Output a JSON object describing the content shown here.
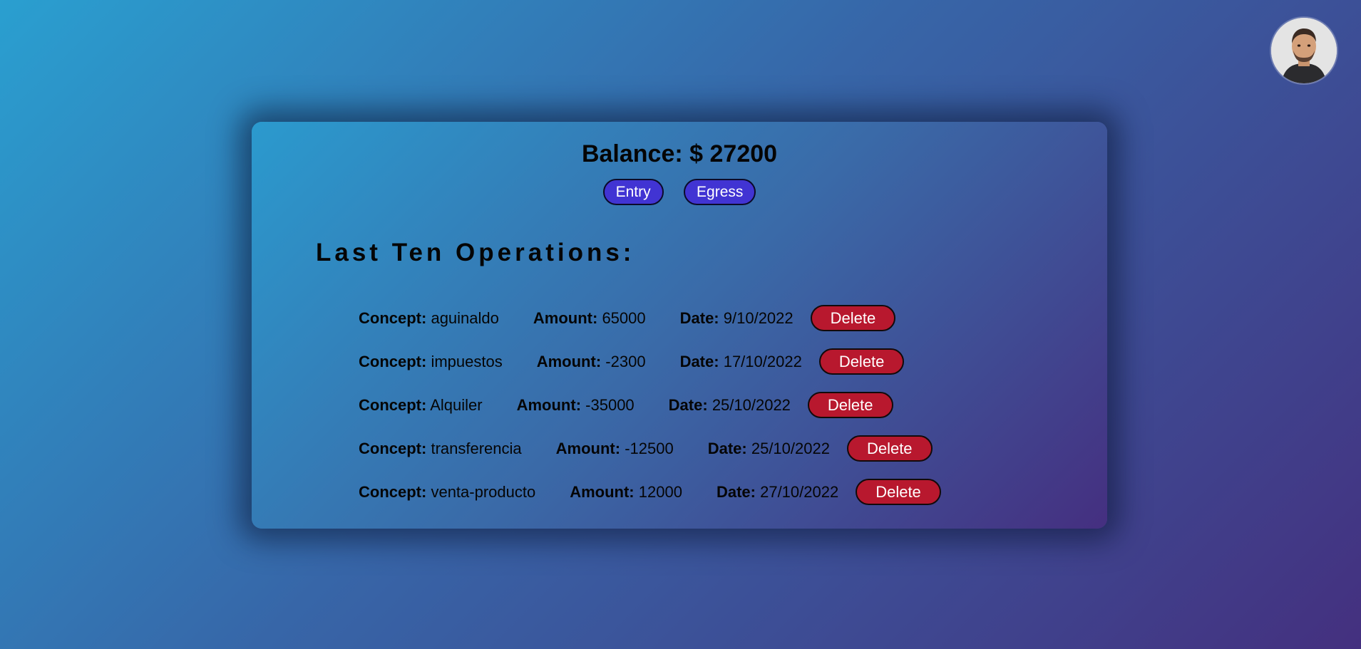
{
  "profile": {
    "avatar_icon": "user-avatar-icon"
  },
  "balance": {
    "label": "Balance:",
    "value": "$ 27200"
  },
  "actions": {
    "entry_label": "Entry",
    "egress_label": "Egress"
  },
  "operations": {
    "title": "Last Ten Operations:",
    "concept_label": "Concept:",
    "amount_label": "Amount:",
    "date_label": "Date:",
    "delete_label": "Delete",
    "items": [
      {
        "concept": "aguinaldo",
        "amount": "65000",
        "date": "9/10/2022"
      },
      {
        "concept": "impuestos",
        "amount": "-2300",
        "date": "17/10/2022"
      },
      {
        "concept": "Alquiler",
        "amount": "-35000",
        "date": "25/10/2022"
      },
      {
        "concept": "transferencia",
        "amount": "-12500",
        "date": "25/10/2022"
      },
      {
        "concept": "venta-producto",
        "amount": "12000",
        "date": "27/10/2022"
      }
    ]
  },
  "colors": {
    "primary_button": "#4134d3",
    "delete_button": "#b8182e",
    "background_start": "#2a9fd0",
    "background_end": "#44307f"
  }
}
